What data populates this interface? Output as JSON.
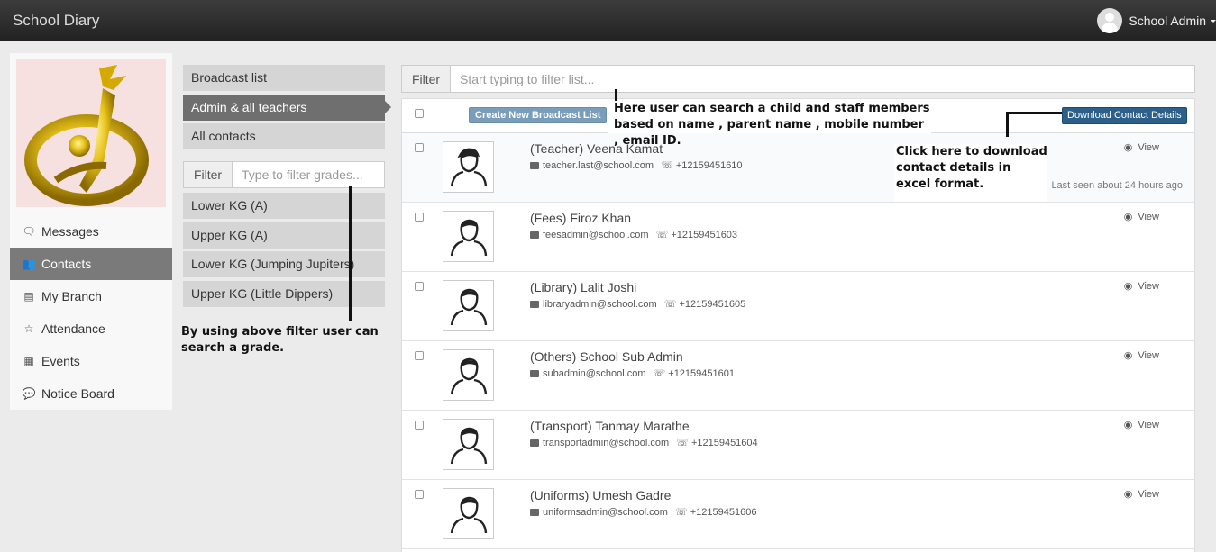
{
  "app": {
    "title": "School Diary",
    "user_name": "School Admin"
  },
  "sidebar": {
    "items": [
      {
        "label": "Messages",
        "icon": "messages-icon",
        "glyph": "🗨"
      },
      {
        "label": "Contacts",
        "icon": "users-icon",
        "glyph": "👥"
      },
      {
        "label": "My Branch",
        "icon": "building-icon",
        "glyph": "▤"
      },
      {
        "label": "Attendance",
        "icon": "star-icon",
        "glyph": "☆"
      },
      {
        "label": "Events",
        "icon": "calendar-icon",
        "glyph": "▦"
      },
      {
        "label": "Notice Board",
        "icon": "comment-icon",
        "glyph": "💬"
      }
    ]
  },
  "lists": {
    "items": [
      {
        "label": "Broadcast list"
      },
      {
        "label": "Admin & all teachers"
      },
      {
        "label": "All contacts"
      }
    ]
  },
  "grade_filter": {
    "label": "Filter",
    "placeholder": "Type to filter grades..."
  },
  "grades": [
    {
      "label": "Lower KG (A)"
    },
    {
      "label": "Upper KG (A)"
    },
    {
      "label": "Lower KG (Jumping Jupiters)"
    },
    {
      "label": "Upper KG (Little Dippers)"
    }
  ],
  "main_filter": {
    "label": "Filter",
    "placeholder": "Start typing to filter list..."
  },
  "toolbar": {
    "create_label": "Create New Broadcast List",
    "download_label": "Download Contact Details"
  },
  "contacts": [
    {
      "name": "(Teacher) Veena Kamat",
      "email": "teacher.last@school.com",
      "phone": "+12159451610",
      "view": "View",
      "last_seen": "Last seen about 24 hours ago"
    },
    {
      "name": "(Fees) Firoz Khan",
      "email": "feesadmin@school.com",
      "phone": "+12159451603",
      "view": "View"
    },
    {
      "name": "(Library) Lalit Joshi",
      "email": "libraryadmin@school.com",
      "phone": "+12159451605",
      "view": "View"
    },
    {
      "name": "(Others) School Sub Admin",
      "email": "subadmin@school.com",
      "phone": "+12159451601",
      "view": "View"
    },
    {
      "name": "(Transport) Tanmay Marathe",
      "email": "transportadmin@school.com",
      "phone": "+12159451604",
      "view": "View"
    },
    {
      "name": "(Uniforms) Umesh Gadre",
      "email": "uniformsadmin@school.com",
      "phone": "+12159451606",
      "view": "View"
    }
  ],
  "annotations": {
    "search_note": "Here user can search a child and staff members based on name , parent name , mobile number , email ID.",
    "download_note": "Click here to download contact details in excel format.",
    "grade_note": "By using above filter user can search a grade."
  },
  "colors": {
    "navbar": "#2b2b2b",
    "active_nav": "#7a7a7a",
    "primary_button": "#2c5f8a",
    "secondary_button": "#7a9dbb"
  }
}
